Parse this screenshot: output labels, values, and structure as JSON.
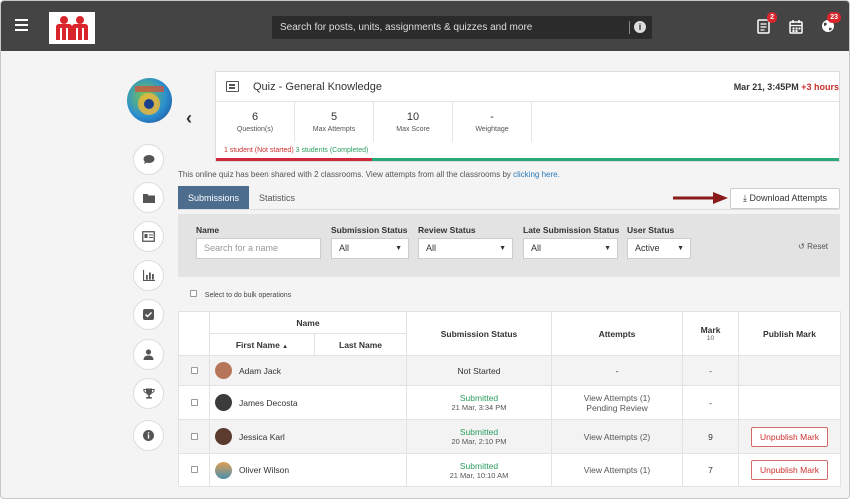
{
  "topbar": {
    "search_placeholder": "Search for posts, units, assignments & quizzes and more",
    "notifications_badge": "2",
    "updates_badge": "23"
  },
  "quiz": {
    "title": "Quiz - General Knowledge",
    "date": "Mar 21, 3:45PM",
    "late": "+3 hours",
    "stats": [
      {
        "value": "6",
        "label": "Question(s)"
      },
      {
        "value": "5",
        "label": "Max Attempts"
      },
      {
        "value": "10",
        "label": "Max Score"
      },
      {
        "value": "-",
        "label": "Weightage"
      }
    ],
    "not_started": "1 student (Not started)",
    "completed": "3 students (Completed)",
    "progress_completed_fraction": 0.75
  },
  "shared_note": "This online quiz has been shared with 2 classrooms. View attempts from all the classrooms by",
  "shared_link": "clicking here.",
  "tabs": [
    "Submissions",
    "Statistics"
  ],
  "download_label": "Download Attempts",
  "filters": {
    "name_label": "Name",
    "name_placeholder": "Search for a name",
    "submission_label": "Submission Status",
    "submission_value": "All",
    "review_label": "Review Status",
    "review_value": "All",
    "late_label": "Late Submission Status",
    "late_value": "All",
    "user_label": "User Status",
    "user_value": "Active",
    "reset_label": "Reset"
  },
  "bulk_label": "Select to do bulk operations",
  "table": {
    "name_header": "Name",
    "first_name_header": "First Name",
    "last_name_header": "Last Name",
    "submission_header": "Submission Status",
    "attempts_header": "Attempts",
    "mark_header": "Mark",
    "mark_max": "10",
    "publish_header": "Publish Mark",
    "rows": [
      {
        "first_name": "Adam Jack",
        "status": "Not Started",
        "time": "",
        "attempts": "-",
        "attempts_sub": "",
        "mark": "-",
        "publish": "",
        "avatar_color": "#b7765a"
      },
      {
        "first_name": "James Decosta",
        "status": "Submitted",
        "time": "21 Mar, 3:34 PM",
        "attempts": "View Attempts (1)",
        "attempts_sub": "Pending Review",
        "mark": "-",
        "publish": "",
        "avatar_color": "#3b3b3b"
      },
      {
        "first_name": "Jessica Karl",
        "status": "Submitted",
        "time": "20 Mar, 2:10 PM",
        "attempts": "View Attempts (2)",
        "attempts_sub": "",
        "mark": "9",
        "publish": "Unpublish Mark",
        "avatar_color": "#5a3b2e"
      },
      {
        "first_name": "Oliver Wilson",
        "status": "Submitted",
        "time": "21 Mar, 10:10 AM",
        "attempts": "View Attempts (1)",
        "attempts_sub": "",
        "mark": "7",
        "publish": "Unpublish Mark",
        "avatar_color": "#4a8fb0"
      }
    ]
  }
}
